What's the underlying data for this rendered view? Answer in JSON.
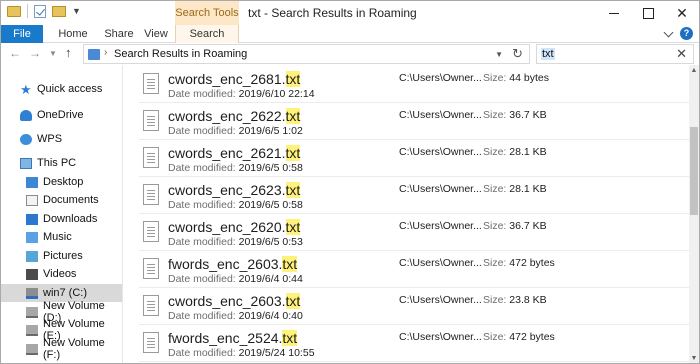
{
  "window": {
    "title": "txt - Search Results in Roaming",
    "context_tab_header": "Search Tools"
  },
  "ribbon": {
    "tabs": [
      "File",
      "Home",
      "Share",
      "View",
      "Search"
    ],
    "help": "?"
  },
  "address": {
    "location": "Search Results in Roaming",
    "search_value": "txt"
  },
  "sidebar": {
    "items": [
      {
        "label": "Quick access",
        "icon": "star-icon"
      },
      {
        "label": "OneDrive",
        "icon": "onedrive-icon"
      },
      {
        "label": "WPS",
        "icon": "wps-icon"
      },
      {
        "label": "This PC",
        "icon": "computer-icon"
      },
      {
        "label": "Desktop",
        "icon": "desktop-folder-icon"
      },
      {
        "label": "Documents",
        "icon": "documents-icon"
      },
      {
        "label": "Downloads",
        "icon": "downloads-icon"
      },
      {
        "label": "Music",
        "icon": "music-icon"
      },
      {
        "label": "Pictures",
        "icon": "pictures-icon"
      },
      {
        "label": "Videos",
        "icon": "videos-icon"
      },
      {
        "label": "win7 (C:)",
        "icon": "system-drive-icon",
        "selected": true
      },
      {
        "label": "New Volume (D:)",
        "icon": "drive-icon"
      },
      {
        "label": "New Volume (E:)",
        "icon": "drive-icon"
      },
      {
        "label": "New Volume (F:)",
        "icon": "drive-icon"
      }
    ]
  },
  "results": {
    "date_label": "Date modified:",
    "size_label": "Size:",
    "items": [
      {
        "name": "cwords_enc_2681.",
        "ext": "txt",
        "date": "2019/6/10 22:14",
        "path": "C:\\Users\\Owner...",
        "size": "44 bytes"
      },
      {
        "name": "cwords_enc_2622.",
        "ext": "txt",
        "date": "2019/6/5 1:02",
        "path": "C:\\Users\\Owner...",
        "size": "36.7 KB"
      },
      {
        "name": "cwords_enc_2621.",
        "ext": "txt",
        "date": "2019/6/5 0:58",
        "path": "C:\\Users\\Owner...",
        "size": "28.1 KB"
      },
      {
        "name": "cwords_enc_2623.",
        "ext": "txt",
        "date": "2019/6/5 0:58",
        "path": "C:\\Users\\Owner...",
        "size": "28.1 KB"
      },
      {
        "name": "cwords_enc_2620.",
        "ext": "txt",
        "date": "2019/6/5 0:53",
        "path": "C:\\Users\\Owner...",
        "size": "36.7 KB"
      },
      {
        "name": "fwords_enc_2603.",
        "ext": "txt",
        "date": "2019/6/4 0:44",
        "path": "C:\\Users\\Owner...",
        "size": "472 bytes"
      },
      {
        "name": "cwords_enc_2603.",
        "ext": "txt",
        "date": "2019/6/4 0:40",
        "path": "C:\\Users\\Owner...",
        "size": "23.8 KB"
      },
      {
        "name": "fwords_enc_2524.",
        "ext": "txt",
        "date": "2019/5/24 10:55",
        "path": "C:\\Users\\Owner...",
        "size": "472 bytes"
      }
    ]
  },
  "colors": {
    "file_tab": "#1979ca",
    "search_tools": "#fde7c7",
    "highlight": "#fff27a",
    "selected_nav": "#d9d9d9"
  }
}
